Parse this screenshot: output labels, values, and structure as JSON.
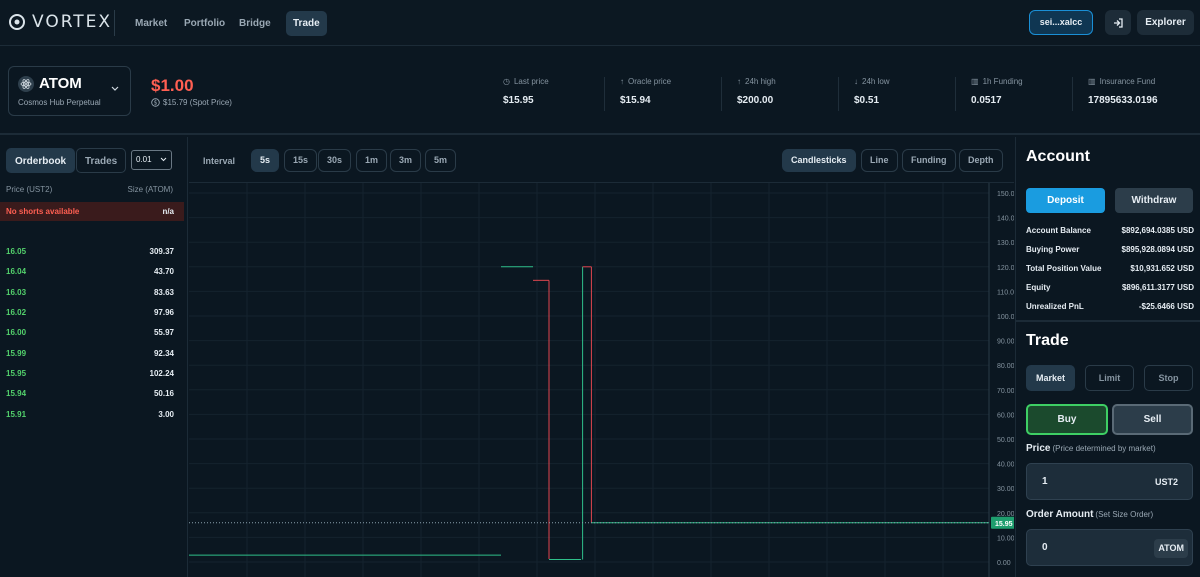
{
  "nav": {
    "logo": "VORTEX",
    "links": [
      {
        "label": "Market"
      },
      {
        "label": "Portfolio"
      },
      {
        "label": "Bridge"
      },
      {
        "label": "Trade",
        "active": true
      }
    ],
    "wallet": "sei...xalcc",
    "explorer": "Explorer"
  },
  "market": {
    "symbol": "ATOM",
    "name": "Cosmos Hub Perpetual",
    "price": "$1.00",
    "spot": "$15.79 (Spot Price)",
    "stats": [
      {
        "label": "Last price",
        "value": "$15.95",
        "icon": "clock-icon"
      },
      {
        "label": "Oracle price",
        "value": "$15.94",
        "icon": "arrow-up-icon"
      },
      {
        "label": "24h high",
        "value": "$200.00",
        "icon": "arrow-up-icon"
      },
      {
        "label": "24h low",
        "value": "$0.51",
        "icon": "arrow-down-icon"
      },
      {
        "label": "1h Funding",
        "value": "0.0517",
        "icon": "bar-chart-icon"
      },
      {
        "label": "Insurance Fund",
        "value": "17895633.0196",
        "icon": "bar-chart-icon"
      }
    ]
  },
  "orderbook": {
    "tabs": [
      "Orderbook",
      "Trades"
    ],
    "tick": "0.01",
    "price_header": "Price (UST2)",
    "size_header": "Size (ATOM)",
    "no_shorts": "No shorts available",
    "no_shorts_value": "n/a",
    "rows": [
      {
        "price": "16.05",
        "size": "309.37"
      },
      {
        "price": "16.04",
        "size": "43.70"
      },
      {
        "price": "16.03",
        "size": "83.63"
      },
      {
        "price": "16.02",
        "size": "97.96"
      },
      {
        "price": "16.00",
        "size": "55.97"
      },
      {
        "price": "15.99",
        "size": "92.34"
      },
      {
        "price": "15.95",
        "size": "102.24"
      },
      {
        "price": "15.94",
        "size": "50.16"
      },
      {
        "price": "15.91",
        "size": "3.00"
      }
    ]
  },
  "chart_toolbar": {
    "interval_label": "Interval",
    "intervals": [
      "5s",
      "15s",
      "30s",
      "1m",
      "3m",
      "5m"
    ],
    "active_interval": "5s",
    "views": [
      "Candlesticks",
      "Line",
      "Funding",
      "Depth"
    ],
    "active_view": "Candlesticks"
  },
  "chart_data": {
    "type": "candlestick",
    "y_ticks": [
      "150.00",
      "140.00",
      "130.00",
      "120.00",
      "110.00",
      "100.00",
      "90.00",
      "80.00",
      "70.00",
      "60.00",
      "50.00",
      "40.00",
      "30.00",
      "20.00",
      "10.00",
      "0.00"
    ],
    "ylim": [
      0,
      150
    ],
    "last_price_label": "15.95",
    "last_price": 15.95,
    "up_color": "#2fbf8a",
    "down_color": "#e0464f",
    "segments": [
      {
        "kind": "flat",
        "color": "up",
        "from": 0.0,
        "to": 0.39,
        "price": 2.8
      },
      {
        "kind": "flat",
        "color": "up",
        "from": 0.39,
        "to": 0.43,
        "price": 120.0
      },
      {
        "kind": "flat",
        "color": "down",
        "from": 0.43,
        "to": 0.45,
        "price": 114.5
      },
      {
        "kind": "vertical",
        "color": "down",
        "at": 0.45,
        "from_price": 114.5,
        "to_price": 1.2
      },
      {
        "kind": "flat",
        "color": "up",
        "from": 0.45,
        "to": 0.49,
        "price": 1.0
      },
      {
        "kind": "vertical",
        "color": "up",
        "at": 0.492,
        "from_price": 1.0,
        "to_price": 120.0
      },
      {
        "kind": "flat",
        "color": "down",
        "from": 0.492,
        "to": 0.503,
        "price": 120.0
      },
      {
        "kind": "vertical",
        "color": "down",
        "at": 0.503,
        "from_price": 120.0,
        "to_price": 15.9
      },
      {
        "kind": "flat",
        "color": "up",
        "from": 0.503,
        "to": 1.0,
        "price": 15.95
      }
    ]
  },
  "account": {
    "title": "Account",
    "deposit": "Deposit",
    "withdraw": "Withdraw",
    "rows": [
      {
        "label": "Account Balance",
        "value": "$892,694.0385 USD"
      },
      {
        "label": "Buying Power",
        "value": "$895,928.0894 USD"
      },
      {
        "label": "Total Position Value",
        "value": "$10,931.652 USD"
      },
      {
        "label": "Equity",
        "value": "$896,611.3177 USD"
      },
      {
        "label": "Unrealized PnL",
        "value": "-$25.6466 USD"
      }
    ]
  },
  "trade": {
    "title": "Trade",
    "types": [
      "Market",
      "Limit",
      "Stop"
    ],
    "active_type": "Market",
    "buy": "Buy",
    "sell": "Sell",
    "price_label": "Price",
    "price_hint": "(Price determined by market)",
    "price_value": "1",
    "price_unit": "UST2",
    "amount_label": "Order Amount",
    "amount_hint": "(Set Size Order)",
    "amount_value": "0",
    "amount_unit": "ATOM"
  }
}
